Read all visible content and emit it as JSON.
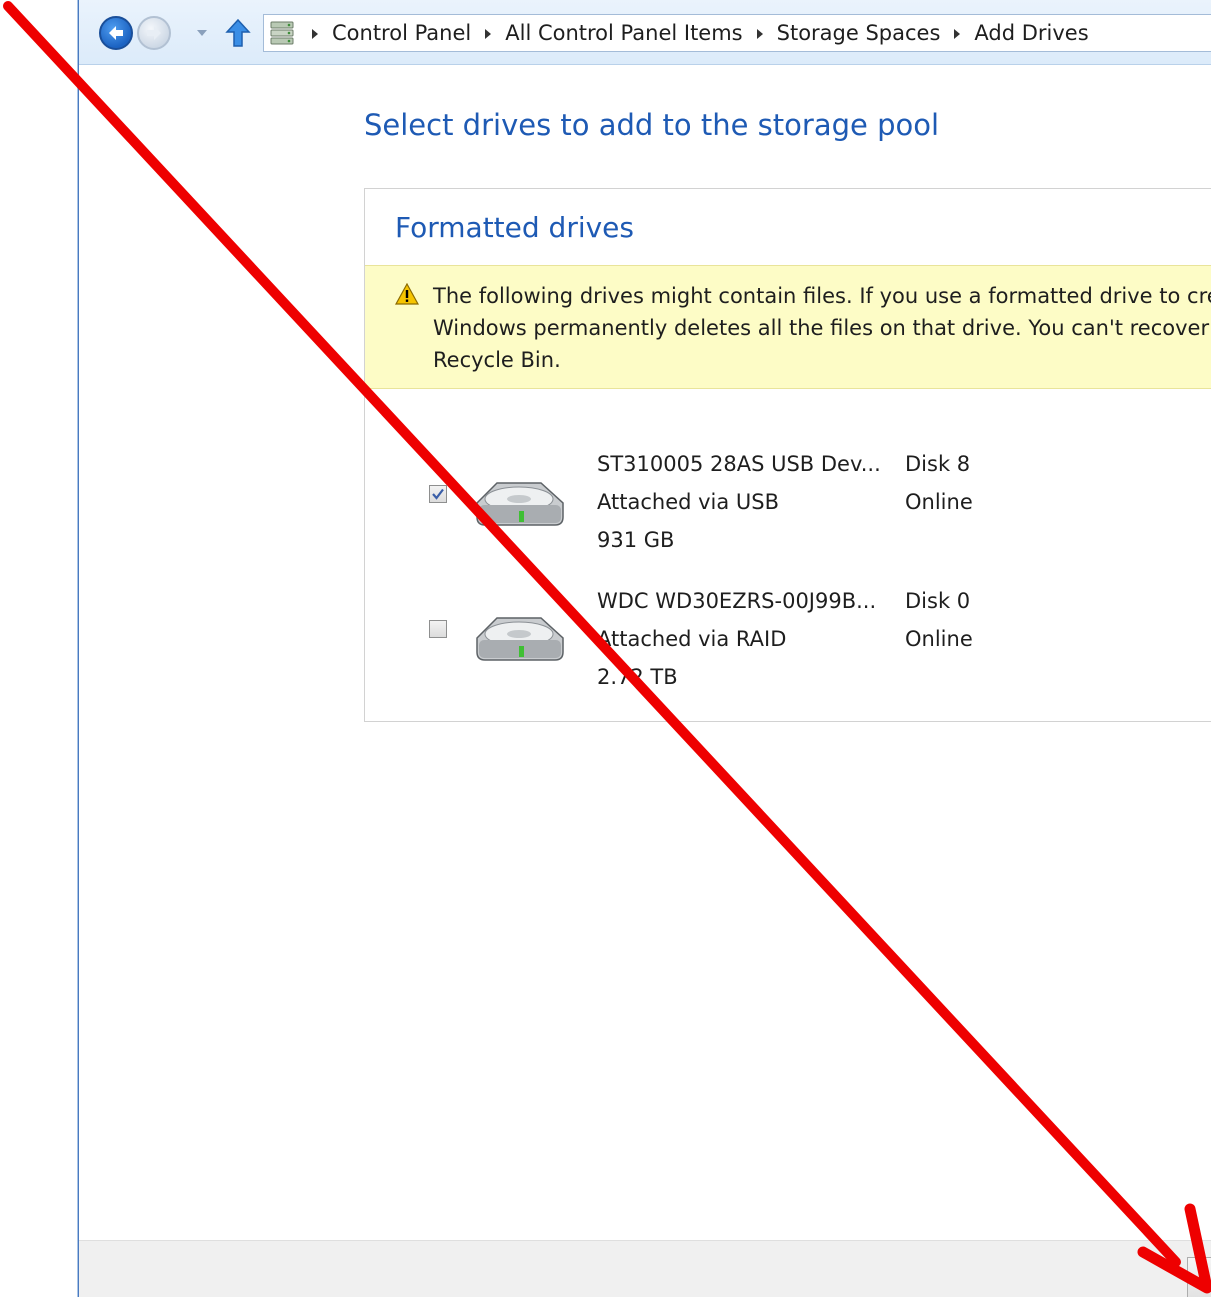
{
  "address_bar": {
    "back_icon": "back-arrow-icon",
    "forward_icon": "forward-arrow-icon",
    "up_icon": "up-arrow-icon",
    "location_icon": "control-panel-icon",
    "breadcrumbs": [
      "Control Panel",
      "All Control Panel Items",
      "Storage Spaces",
      "Add Drives"
    ]
  },
  "page": {
    "title": "Select drives to add to the storage pool"
  },
  "panel": {
    "title": "Formatted drives",
    "warning": {
      "icon": "warning-icon",
      "lines": [
        "The following drives might contain files. If you use a formatted drive to cre",
        "Windows permanently deletes all the files on that drive. You can't recover",
        "Recycle Bin."
      ]
    },
    "drives": [
      {
        "checked": true,
        "name": "ST310005 28AS USB Dev...",
        "connection": "Attached via USB",
        "size": "931 GB",
        "disk": "Disk 8",
        "status": "Online"
      },
      {
        "checked": false,
        "name": "WDC WD30EZRS-00J99B...",
        "connection": "Attached via RAID",
        "size": "2.72 TB",
        "disk": "Disk 0",
        "status": "Online"
      }
    ]
  },
  "annotation": {
    "type": "arrow",
    "color": "#ee0000"
  }
}
